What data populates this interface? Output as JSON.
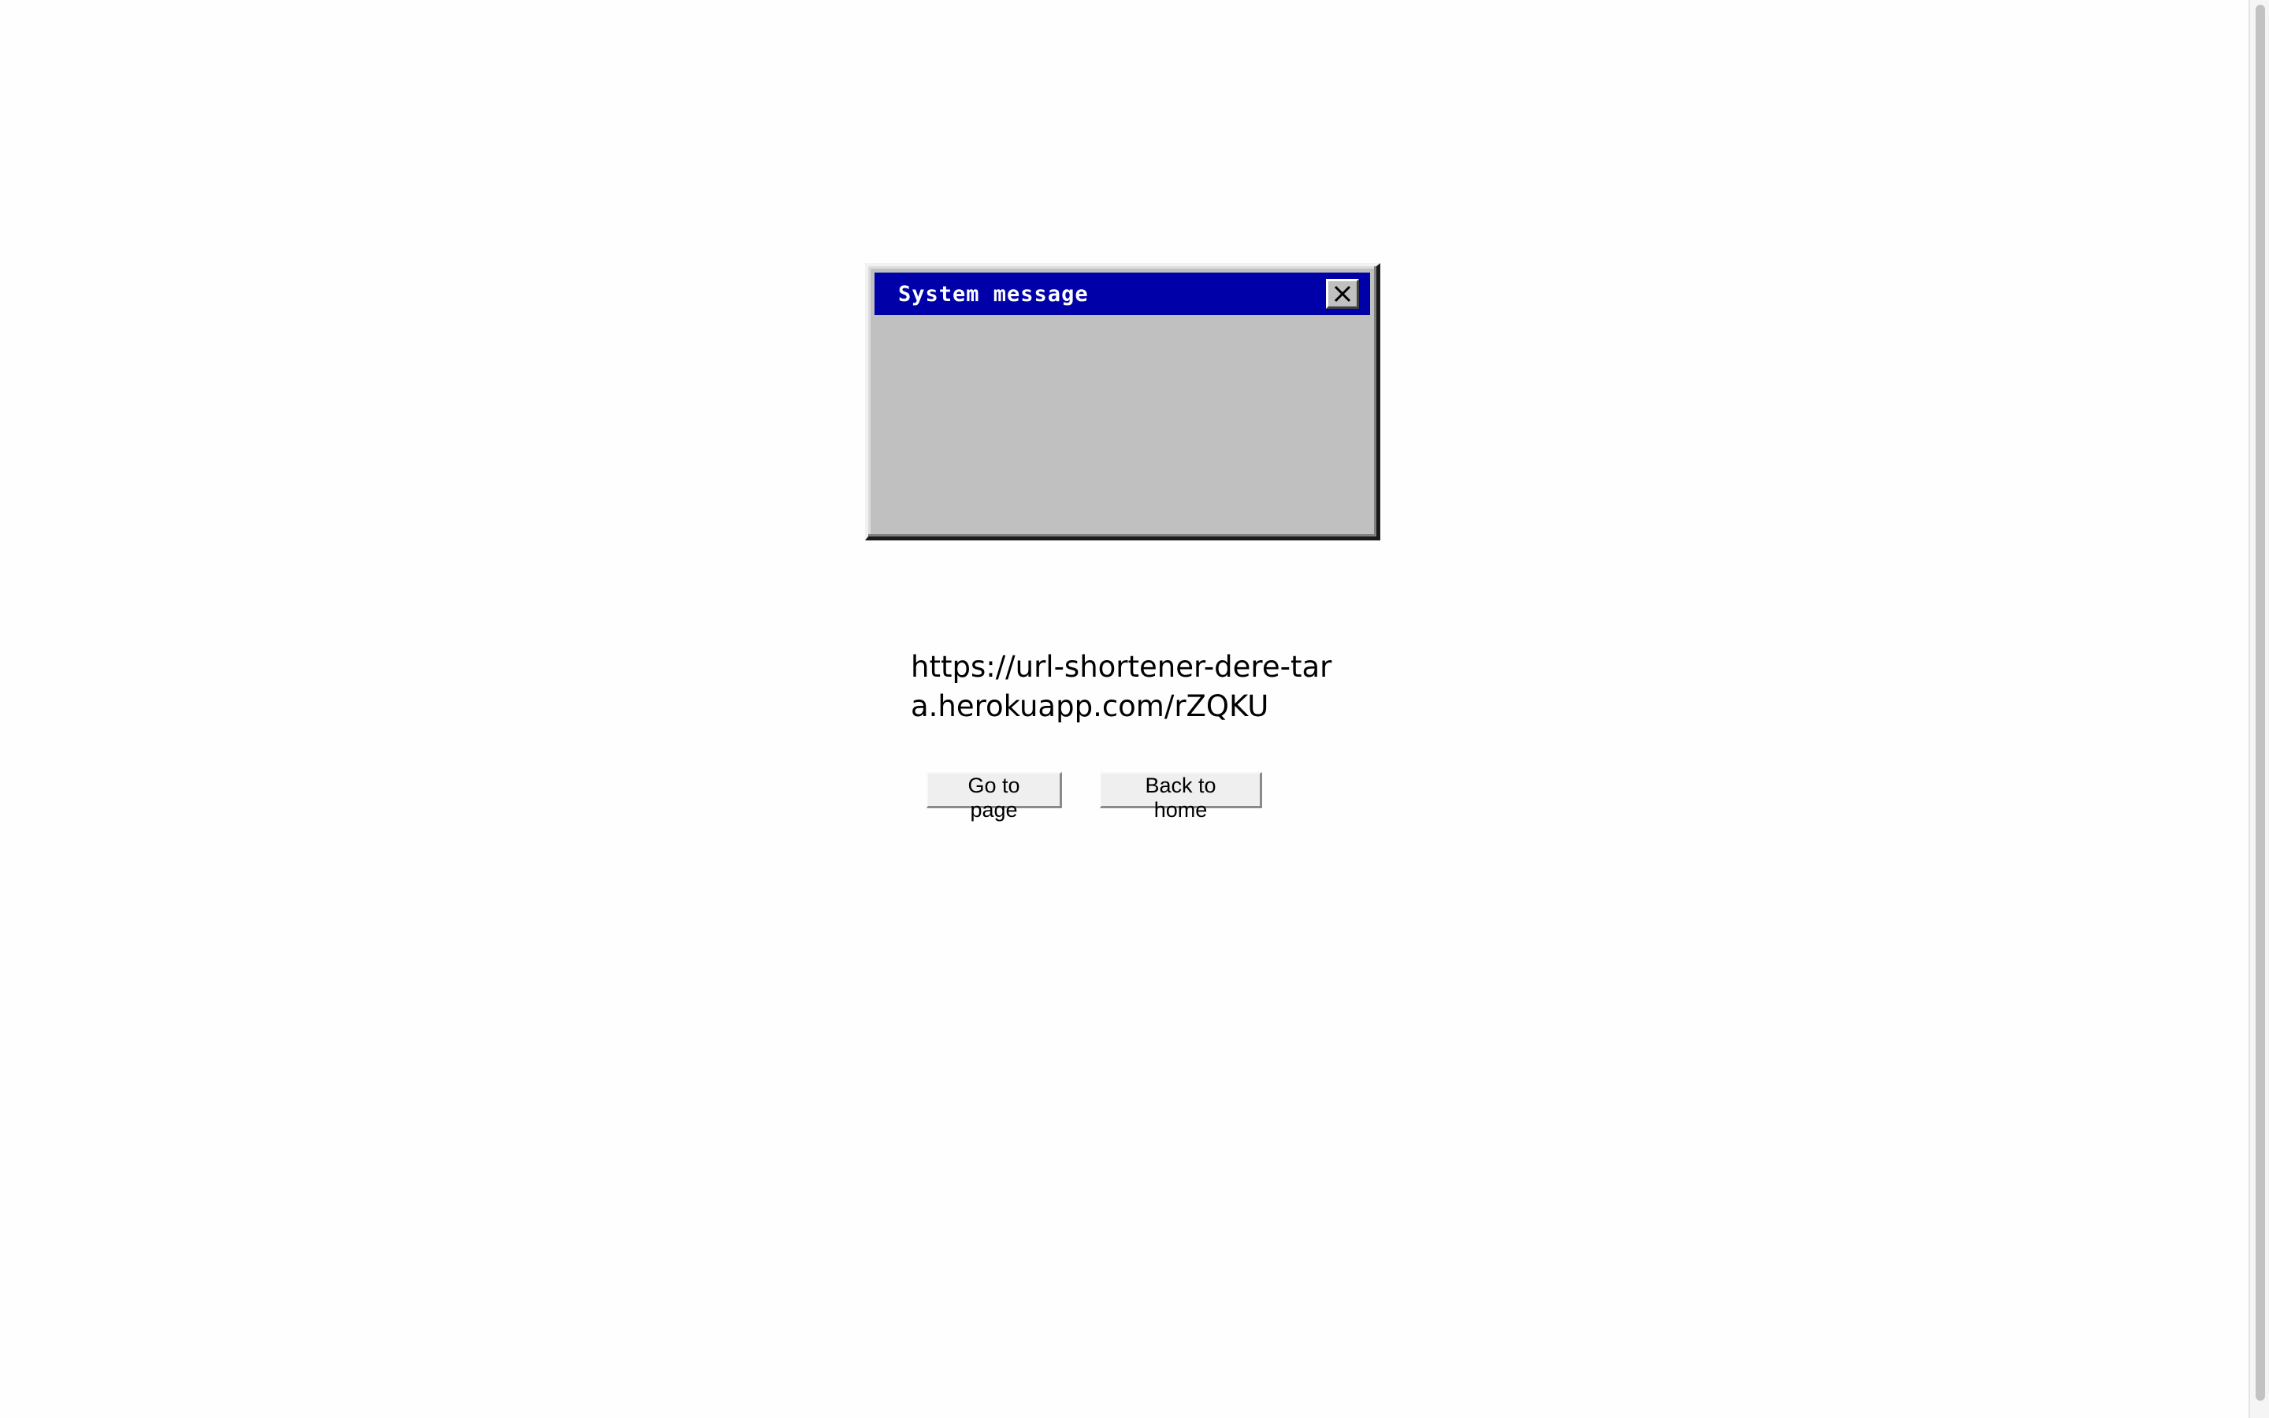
{
  "dialog": {
    "title": "System message",
    "close_icon": "close-x-icon",
    "body_text": ""
  },
  "short_url": "https://url-shortener-dere-tara.herokuapp.com/rZQKU",
  "buttons": {
    "go_to_page": "Go to page",
    "back_to_home": "Back to home"
  },
  "colors": {
    "titlebar": "#0000a8",
    "dialog_bg": "#c0c0c0",
    "page_bg": "#fefefe"
  }
}
